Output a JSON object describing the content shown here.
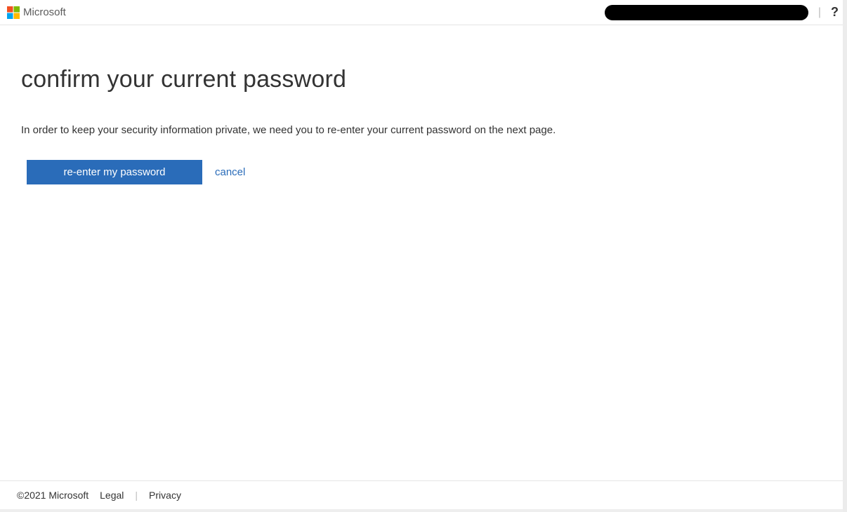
{
  "header": {
    "brand": "Microsoft"
  },
  "main": {
    "title": "confirm your current password",
    "description": "In order to keep your security information private, we need you to re-enter your current password on the next page.",
    "reenter_button": "re-enter my password",
    "cancel_link": "cancel"
  },
  "footer": {
    "copyright": "©2021 Microsoft",
    "legal": "Legal",
    "privacy": "Privacy"
  }
}
